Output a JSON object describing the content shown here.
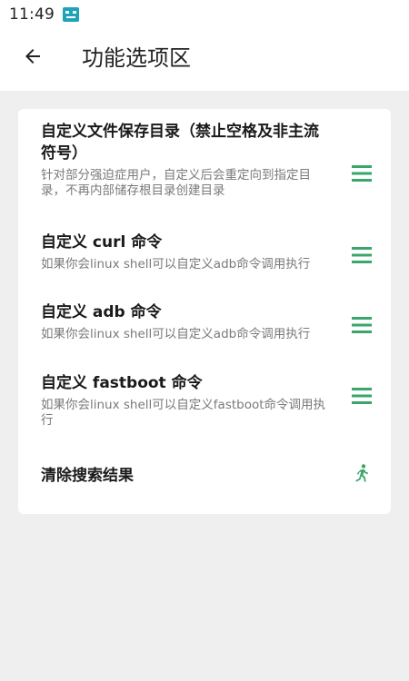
{
  "status": {
    "time": "11:49",
    "icon": "notification-icon"
  },
  "appbar": {
    "title": "功能选项区",
    "back_icon": "arrow-back-icon"
  },
  "colors": {
    "accent": "#3aa66b",
    "background": "#efefef",
    "card": "#ffffff",
    "text_primary": "#1a1a1a",
    "text_secondary": "#7a7a7a"
  },
  "options": [
    {
      "title": "自定义文件保存目录（禁止空格及非主流符号）",
      "desc": "针对部分强迫症用户，自定义后会重定向到指定目录，不再内部储存根目录创建目录",
      "icon": "menu-icon"
    },
    {
      "title": "自定义 curl 命令",
      "desc": "如果你会linux shell可以自定义adb命令调用执行",
      "icon": "menu-icon"
    },
    {
      "title": "自定义 adb 命令",
      "desc": "如果你会linux shell可以自定义adb命令调用执行",
      "icon": "menu-icon"
    },
    {
      "title": "自定义 fastboot 命令",
      "desc": "如果你会linux shell可以自定义fastboot命令调用执行",
      "icon": "menu-icon"
    },
    {
      "title": "清除搜索结果",
      "desc": "",
      "icon": "run-icon"
    }
  ]
}
